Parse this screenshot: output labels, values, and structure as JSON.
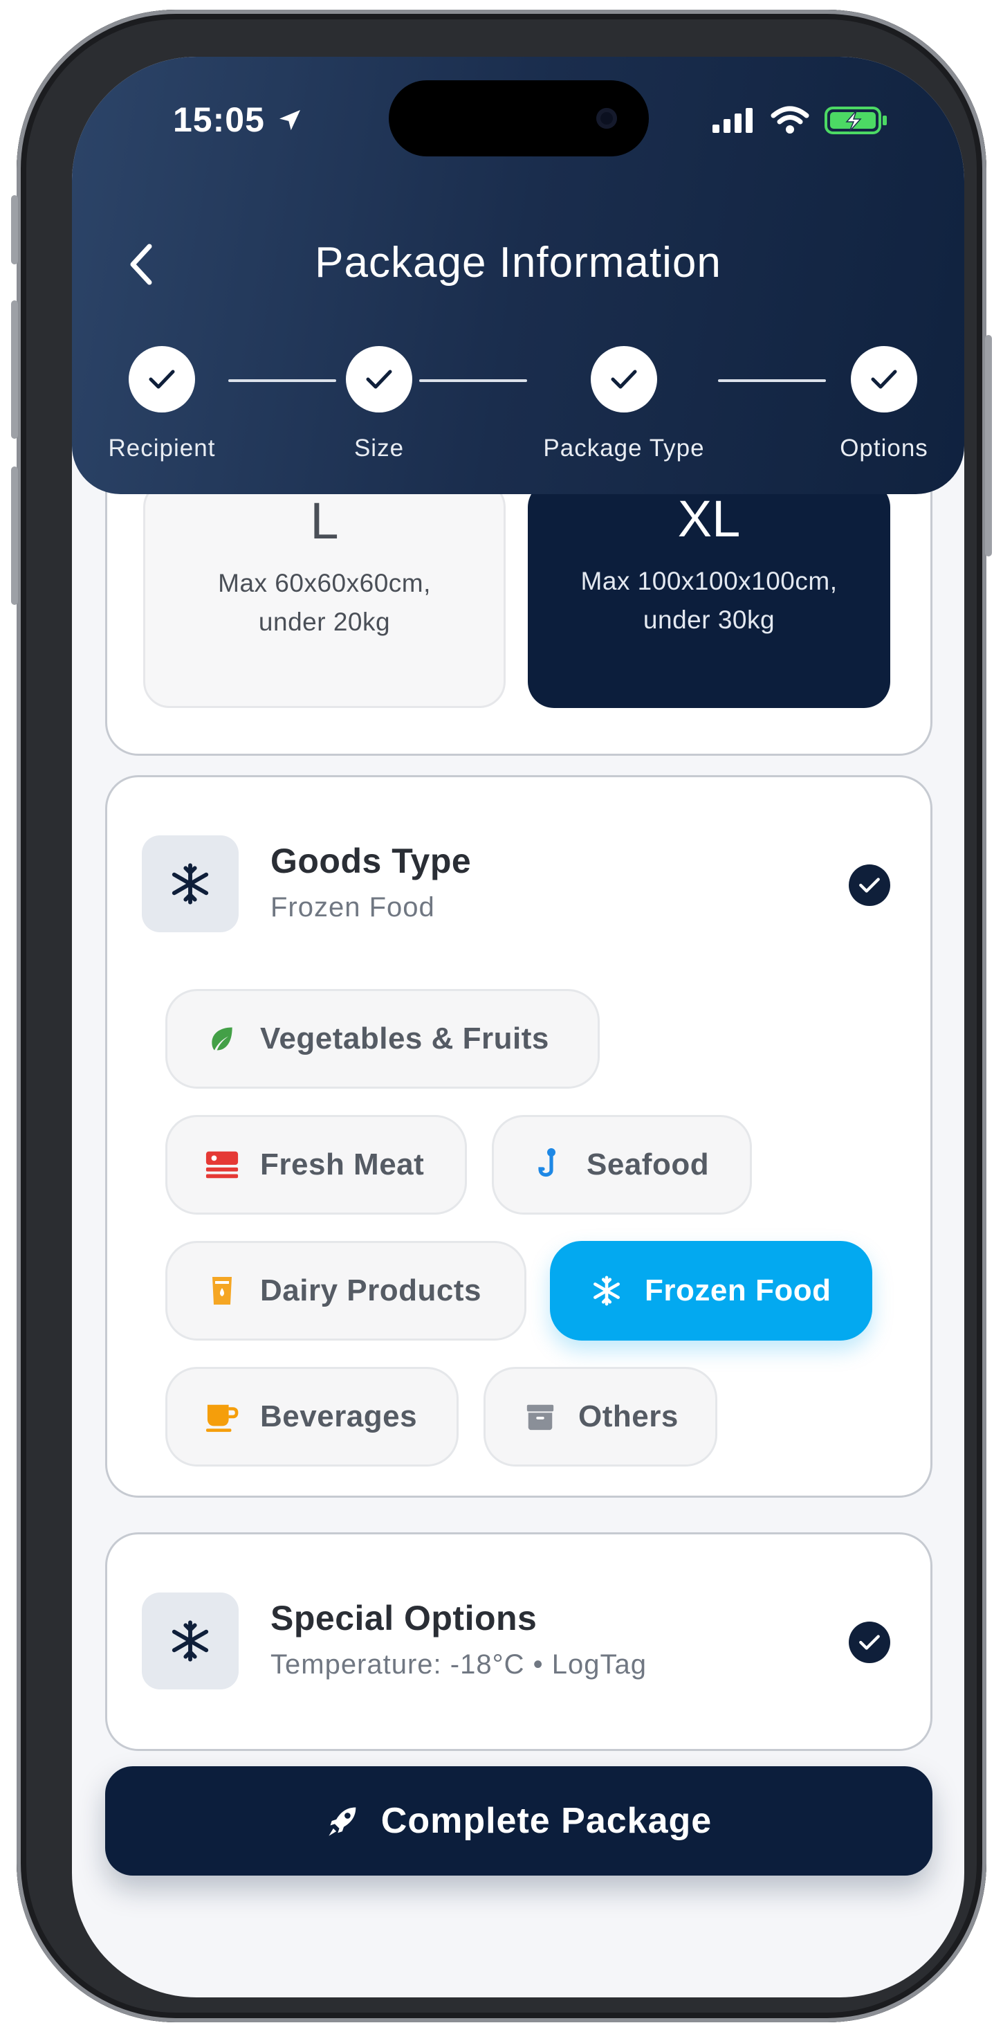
{
  "status_bar": {
    "time": "15:05"
  },
  "header": {
    "title": "Package Information",
    "steps": [
      {
        "label": "Recipient",
        "done": true
      },
      {
        "label": "Size",
        "done": true
      },
      {
        "label": "Package Type",
        "done": true
      },
      {
        "label": "Options",
        "done": true
      }
    ]
  },
  "size_options": [
    {
      "size": "L",
      "desc_line1": "Max 60x60x60cm,",
      "desc_line2": "under 20kg",
      "selected": false
    },
    {
      "size": "XL",
      "desc_line1": "Max 100x100x100cm,",
      "desc_line2": "under 30kg",
      "selected": true
    }
  ],
  "goods_type": {
    "title": "Goods Type",
    "selected_label": "Frozen Food",
    "icon": "snowflake-icon",
    "chips": [
      {
        "label": "Vegetables & Fruits",
        "icon": "leaf-icon",
        "color": "#43a047"
      },
      {
        "label": "Fresh Meat",
        "icon": "meat-icon",
        "color": "#e53935"
      },
      {
        "label": "Seafood",
        "icon": "fishhook-icon",
        "color": "#1e88e5"
      },
      {
        "label": "Dairy Products",
        "icon": "milk-icon",
        "color": "#f5a623"
      },
      {
        "label": "Frozen Food",
        "icon": "snowflake-icon",
        "color": "#03a9f0",
        "active": true
      },
      {
        "label": "Beverages",
        "icon": "cup-icon",
        "color": "#f59e0b"
      },
      {
        "label": "Others",
        "icon": "archive-icon",
        "color": "#8a8f98"
      }
    ]
  },
  "special_options": {
    "title": "Special Options",
    "summary": "Temperature: -18°C • LogTag",
    "icon": "snowflake-icon"
  },
  "cta": {
    "label": "Complete Package",
    "icon": "rocket-icon"
  },
  "colors": {
    "header_dark": "#10223f",
    "accent": "#03a9f0",
    "navy": "#0c1e3c"
  }
}
